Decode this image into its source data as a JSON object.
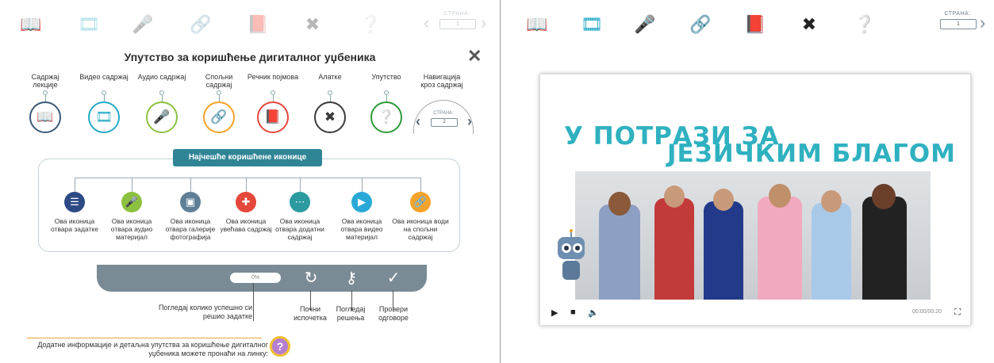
{
  "left_toolbar": {
    "page_label": "СТРАНА:",
    "page_value": "1"
  },
  "right_toolbar": {
    "page_label": "СТРАНА:",
    "page_value": "1"
  },
  "dialog": {
    "title": "Упутство за коришћење дигиталног уџбеника",
    "categories": [
      {
        "label": "Садржај лекције",
        "color": "#3b5a7a"
      },
      {
        "label": "Видео садржај",
        "color": "#23a9c6"
      },
      {
        "label": "Аудио садржај",
        "color": "#8cc13f"
      },
      {
        "label": "Спољни садржај",
        "color": "#f4a32b"
      },
      {
        "label": "Речник појмова",
        "color": "#e5473a"
      },
      {
        "label": "Алатке",
        "color": "#3a3a3a"
      },
      {
        "label": "Упутство",
        "color": "#2e9a3a"
      },
      {
        "label": "Навигација кроз садржај",
        "color": "#5a6a78"
      }
    ],
    "nav_mini_label": "СТРАНА:",
    "nav_mini_value": "2",
    "common_title": "Најчешће коришћене иконице",
    "common_icons": [
      {
        "label": "Ова иконица отвара задатке",
        "color": "#2d4a86"
      },
      {
        "label": "Ова иконица отвара аудио материјал",
        "color": "#8cc13f"
      },
      {
        "label": "Ова иконица отвара галерије фотографија",
        "color": "#5f7f96"
      },
      {
        "label": "Ова иконица увећава садржај",
        "color": "#e5473a"
      },
      {
        "label": "Ова иконица отвара додатни садржај",
        "color": "#2c9ba0"
      },
      {
        "label": "Ова иконица отвара видео материјал",
        "color": "#2aa9d8"
      },
      {
        "label": "Ова иконица води на спољни садржај",
        "color": "#f4a32b"
      }
    ],
    "progress_value": "0%",
    "control_labels": [
      "Погледај колико успешно си решио задатке",
      "Почни испочетка",
      "Погледај решења",
      "Провери одговоре"
    ],
    "footer_text": "Додатне информације и детаљна упутства за коришћење дигиталног уџбеника можете пронаћи на линку:"
  },
  "video": {
    "title_line1": "У ПОТРАЗИ ЗА",
    "title_line2": "ЈЕЗИЧКИМ БЛАГОМ",
    "time": "00:00/00:20"
  }
}
